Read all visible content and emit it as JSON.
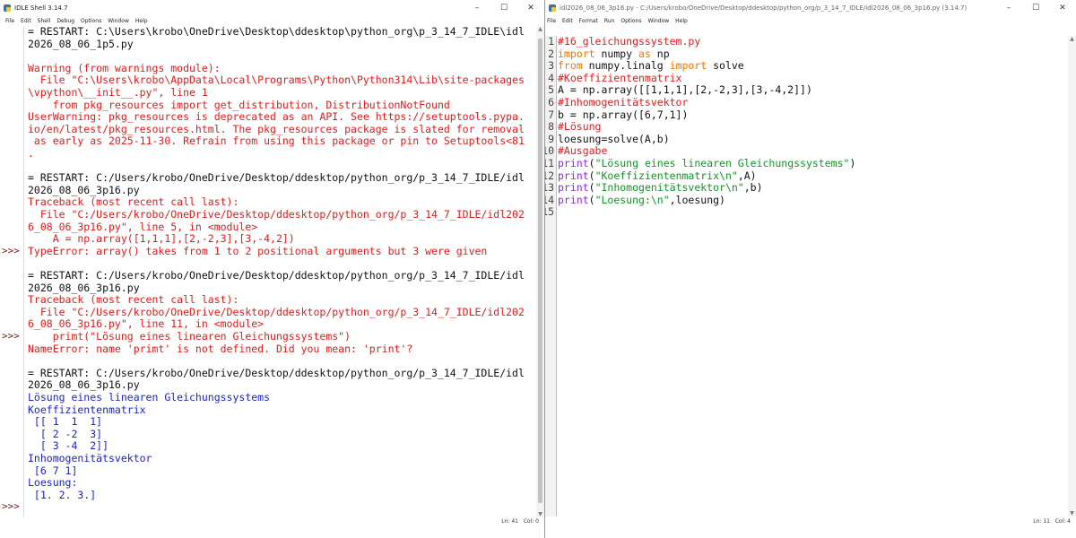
{
  "shell": {
    "title": "IDLE Shell 3.14.7",
    "menu": [
      "File",
      "Edit",
      "Shell",
      "Debug",
      "Options",
      "Window",
      "Help"
    ],
    "controls": [
      "–",
      "☐",
      "✕"
    ],
    "lines": [
      {
        "t": "= RESTART: C:\\Users\\krobo\\OneDrive\\Desktop\\ddesktop\\python_org\\p_3_14_7_IDLE\\idl",
        "c": "black"
      },
      {
        "t": "2026_08_06_1p5.py",
        "c": "black"
      },
      {
        "t": "",
        "c": "black"
      },
      {
        "t": "Warning (from warnings module):",
        "c": "red"
      },
      {
        "t": "  File \"C:\\Users\\krobo\\AppData\\Local\\Programs\\Python\\Python314\\Lib\\site-packages",
        "c": "red"
      },
      {
        "t": "\\vpython\\__init__.py\", line 1",
        "c": "red"
      },
      {
        "t": "    from pkg_resources import get_distribution, DistributionNotFound",
        "c": "red"
      },
      {
        "t": "UserWarning: pkg_resources is deprecated as an API. See https://setuptools.pypa.",
        "c": "red"
      },
      {
        "t": "io/en/latest/pkg_resources.html. The pkg_resources package is slated for removal",
        "c": "red"
      },
      {
        "t": " as early as 2025-11-30. Refrain from using this package or pin to Setuptools<81",
        "c": "red"
      },
      {
        "t": ".",
        "c": "red"
      },
      {
        "t": "",
        "c": "black"
      },
      {
        "t": "= RESTART: C:/Users/krobo/OneDrive/Desktop/ddesktop/python_org/p_3_14_7_IDLE/idl",
        "c": "black"
      },
      {
        "t": "2026_08_06_3p16.py",
        "c": "black"
      },
      {
        "t": "Traceback (most recent call last):",
        "c": "red"
      },
      {
        "t": "  File \"C:/Users/krobo/OneDrive/Desktop/ddesktop/python_org/p_3_14_7_IDLE/idl202",
        "c": "red"
      },
      {
        "t": "6_08_06_3p16.py\", line 5, in <module>",
        "c": "red"
      },
      {
        "t": "    A = np.array([1,1,1],[2,-2,3],[3,-4,2])",
        "c": "red"
      },
      {
        "t": "TypeError: array() takes from 1 to 2 positional arguments but 3 were given",
        "c": "red"
      },
      {
        "t": "",
        "c": "black"
      },
      {
        "t": "= RESTART: C:/Users/krobo/OneDrive/Desktop/ddesktop/python_org/p_3_14_7_IDLE/idl",
        "c": "black"
      },
      {
        "t": "2026_08_06_3p16.py",
        "c": "black"
      },
      {
        "t": "Traceback (most recent call last):",
        "c": "red"
      },
      {
        "t": "  File \"C:/Users/krobo/OneDrive/Desktop/ddesktop/python_org/p_3_14_7_IDLE/idl202",
        "c": "red"
      },
      {
        "t": "6_08_06_3p16.py\", line 11, in <module>",
        "c": "red"
      },
      {
        "t": "    primt(\"Lösung eines linearen Gleichungssystems\")",
        "c": "red"
      },
      {
        "t": "NameError: name 'primt' is not defined. Did you mean: 'print'?",
        "c": "red"
      },
      {
        "t": "",
        "c": "black"
      },
      {
        "t": "= RESTART: C:/Users/krobo/OneDrive/Desktop/ddesktop/python_org/p_3_14_7_IDLE/idl",
        "c": "black"
      },
      {
        "t": "2026_08_06_3p16.py",
        "c": "black"
      },
      {
        "t": "Lösung eines linearen Gleichungssystems",
        "c": "blue"
      },
      {
        "t": "Koeffizientenmatrix",
        "c": "blue"
      },
      {
        "t": " [[ 1  1  1]",
        "c": "blue"
      },
      {
        "t": "  [ 2 -2  3]",
        "c": "blue"
      },
      {
        "t": "  [ 3 -4  2]]",
        "c": "blue"
      },
      {
        "t": "Inhomogenitätsvektor",
        "c": "blue"
      },
      {
        "t": " [6 7 1]",
        "c": "blue"
      },
      {
        "t": "Loesung:",
        "c": "blue"
      },
      {
        "t": " [1. 2. 3.]",
        "c": "blue"
      }
    ],
    "prompts": [
      ">>>",
      ">>>",
      ">>>"
    ],
    "prompt_lines": [
      18,
      25,
      39
    ],
    "status": {
      "ln": "Ln: 41",
      "col": "Col: 0"
    }
  },
  "editor": {
    "title": "idl2026_08_06_3p16.py - C:/Users/krobo/OneDrive/Desktop/ddesktop/python_org/p_3_14_7_IDLE/idl2026_08_06_3p16.py (3.14.7)",
    "menu": [
      "File",
      "Edit",
      "Format",
      "Run",
      "Options",
      "Window",
      "Help"
    ],
    "controls": [
      "–",
      "☐",
      "✕"
    ],
    "line_numbers": [
      "1",
      "2",
      "3",
      "4",
      "5",
      "6",
      "7",
      "8",
      "9",
      "10",
      "11",
      "12",
      "13",
      "14",
      "15"
    ],
    "code": [
      [
        {
          "t": "#16_gleichungssystem.py",
          "c": "com"
        }
      ],
      [
        {
          "t": "import",
          "c": "kw"
        },
        {
          "t": " numpy ",
          "c": "txt"
        },
        {
          "t": "as",
          "c": "kw"
        },
        {
          "t": " np",
          "c": "txt"
        }
      ],
      [
        {
          "t": "from",
          "c": "kw"
        },
        {
          "t": " numpy.linalg ",
          "c": "txt"
        },
        {
          "t": "import",
          "c": "kw"
        },
        {
          "t": " solve",
          "c": "txt"
        }
      ],
      [
        {
          "t": "#Koeffizientenmatrix",
          "c": "com"
        }
      ],
      [
        {
          "t": "A = np.array([[1,1,1],[2,-2,3],[3,-4,2]])",
          "c": "txt"
        }
      ],
      [
        {
          "t": "#Inhomogenitätsvektor",
          "c": "com"
        }
      ],
      [
        {
          "t": "b = np.array([6,7,1])",
          "c": "txt"
        }
      ],
      [
        {
          "t": "#Lösung",
          "c": "com"
        }
      ],
      [
        {
          "t": "loesung=solve(A,b)",
          "c": "txt"
        }
      ],
      [
        {
          "t": "#Ausgabe",
          "c": "com"
        }
      ],
      [
        {
          "t": "print",
          "c": "bi"
        },
        {
          "t": "(",
          "c": "txt"
        },
        {
          "t": "\"Lösung eines linearen Gleichungssystems\"",
          "c": "str"
        },
        {
          "t": ")",
          "c": "txt"
        }
      ],
      [
        {
          "t": "print",
          "c": "bi"
        },
        {
          "t": "(",
          "c": "txt"
        },
        {
          "t": "\"Koeffizientenmatrix\\n\"",
          "c": "str"
        },
        {
          "t": ",A)",
          "c": "txt"
        }
      ],
      [
        {
          "t": "print",
          "c": "bi"
        },
        {
          "t": "(",
          "c": "txt"
        },
        {
          "t": "\"Inhomogenitätsvektor\\n\"",
          "c": "str"
        },
        {
          "t": ",b)",
          "c": "txt"
        }
      ],
      [
        {
          "t": "print",
          "c": "bi"
        },
        {
          "t": "(",
          "c": "txt"
        },
        {
          "t": "\"Loesung:\\n\"",
          "c": "str"
        },
        {
          "t": ",loesung)",
          "c": "txt"
        }
      ],
      []
    ],
    "status": {
      "ln": "Ln: 11",
      "col": "Col: 4"
    }
  }
}
